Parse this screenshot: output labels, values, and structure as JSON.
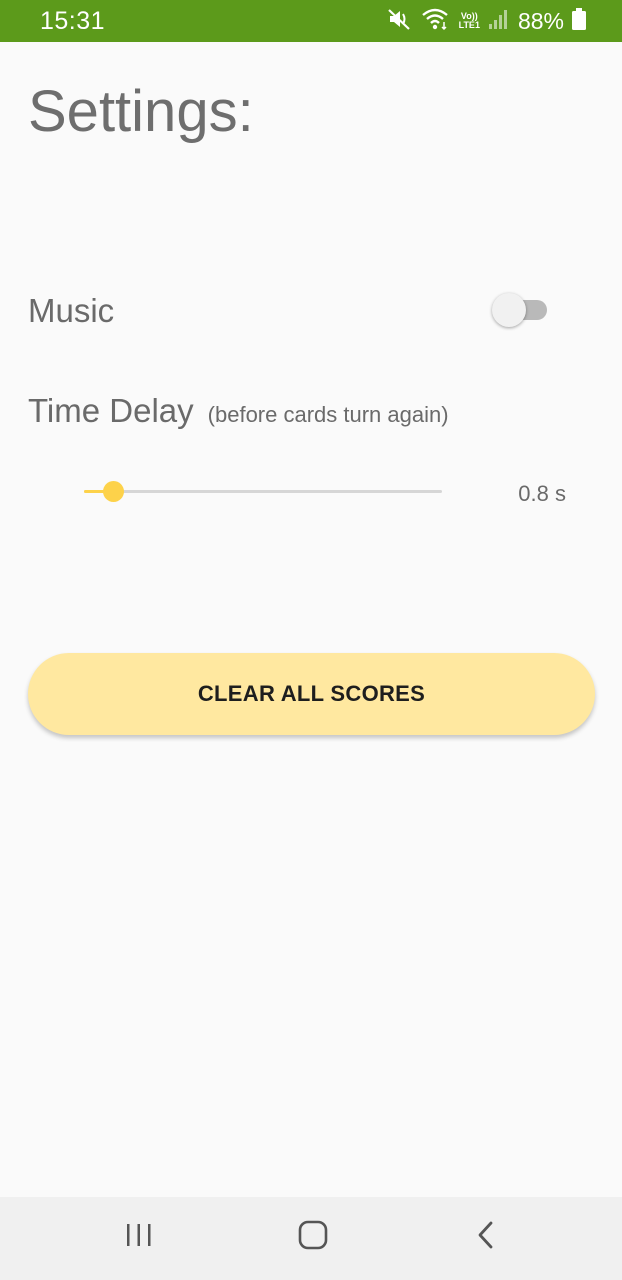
{
  "status_bar": {
    "time": "15:31",
    "network_top": "Vo))",
    "network_bottom": "LTE1",
    "battery_percent": "88%",
    "icons": [
      "mute-icon",
      "wifi-icon",
      "signal-icon",
      "battery-icon"
    ],
    "background_color": "#5c9a1b"
  },
  "page": {
    "title": "Settings:"
  },
  "music": {
    "label": "Music",
    "enabled": false
  },
  "time_delay": {
    "label": "Time Delay",
    "hint": "(before cards turn again)",
    "value_text": "0.8 s",
    "slider_fraction": 0.08,
    "accent_color": "#fdd24a"
  },
  "clear_button": {
    "label": "CLEAR ALL SCORES",
    "color": "#ffe8a0"
  },
  "nav_bar": {
    "buttons": [
      "recent-apps-icon",
      "home-icon",
      "back-icon"
    ]
  }
}
